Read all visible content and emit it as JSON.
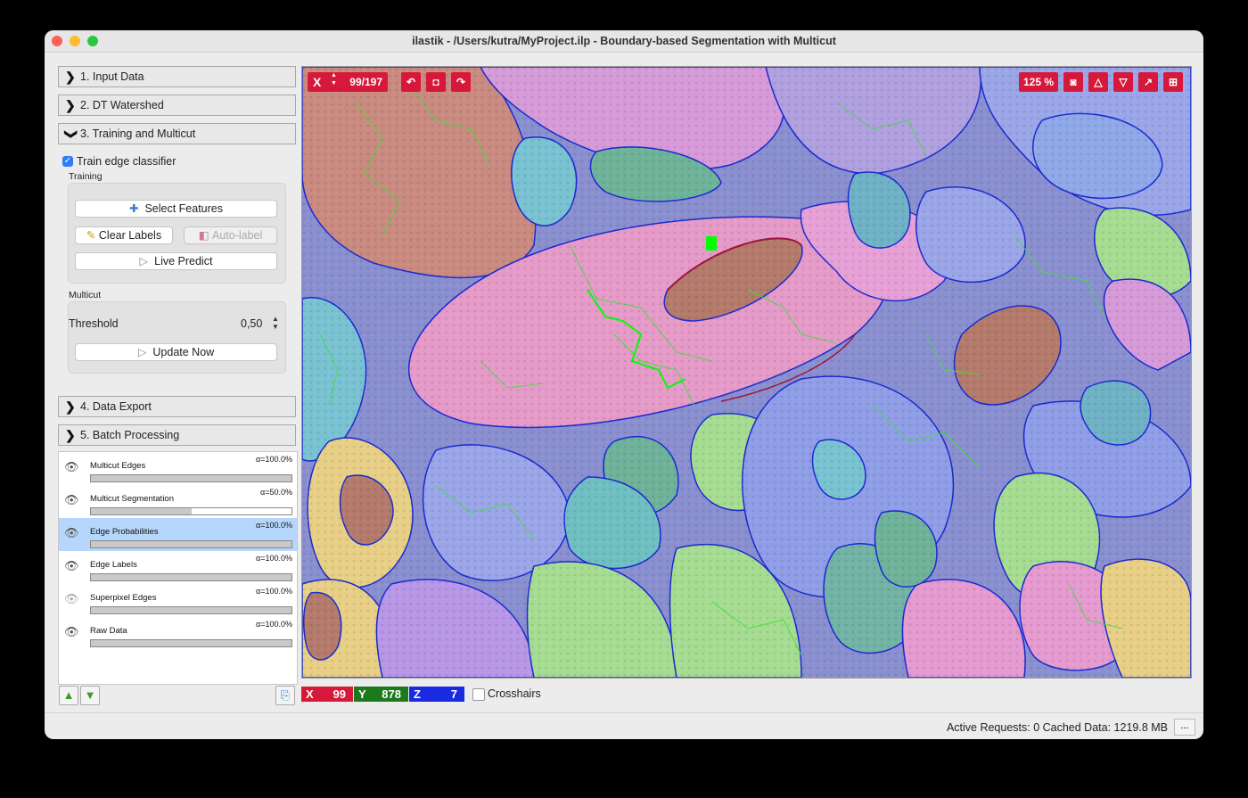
{
  "window": {
    "title": "ilastik - /Users/kutra/MyProject.ilp - Boundary-based Segmentation with Multicut"
  },
  "applets": [
    {
      "label": "1. Input Data",
      "expanded": false
    },
    {
      "label": "2. DT Watershed",
      "expanded": false
    },
    {
      "label": "3. Training and Multicut",
      "expanded": true
    },
    {
      "label": "4. Data Export",
      "expanded": false
    },
    {
      "label": "5. Batch Processing",
      "expanded": false
    }
  ],
  "training_multicut": {
    "train_edge_classifier_label": "Train edge classifier",
    "train_edge_classifier_checked": true,
    "training_group_label": "Training",
    "select_features_label": "Select Features",
    "clear_labels_label": "Clear Labels",
    "auto_label_label": "Auto-label",
    "live_predict_label": "Live Predict",
    "multicut_group_label": "Multicut",
    "threshold_label": "Threshold",
    "threshold_value": "0,50",
    "update_now_label": "Update Now"
  },
  "layers": [
    {
      "name": "Multicut Edges",
      "alpha": "α=100.0%",
      "opacity": 1.0,
      "visible": true,
      "selected": false
    },
    {
      "name": "Multicut Segmentation",
      "alpha": "α=50.0%",
      "opacity": 0.5,
      "visible": true,
      "selected": false
    },
    {
      "name": "Edge Probabilities",
      "alpha": "α=100.0%",
      "opacity": 1.0,
      "visible": true,
      "selected": true
    },
    {
      "name": "Edge Labels",
      "alpha": "α=100.0%",
      "opacity": 1.0,
      "visible": true,
      "selected": false
    },
    {
      "name": "Superpixel Edges",
      "alpha": "α=100.0%",
      "opacity": 1.0,
      "visible": false,
      "selected": false
    },
    {
      "name": "Raw Data",
      "alpha": "α=100.0%",
      "opacity": 1.0,
      "visible": true,
      "selected": false
    }
  ],
  "viewer": {
    "axis_label": "X",
    "slice": "99/197",
    "zoom": "125 %",
    "accent_color": "#d6193a"
  },
  "position": {
    "x_label": "X",
    "x": "99",
    "y_label": "Y",
    "y": "878",
    "z_label": "Z",
    "z": "7",
    "crosshairs_label": "Crosshairs",
    "crosshairs_checked": false
  },
  "status": {
    "text": "Active Requests: 0  Cached Data: 1219.8 MB",
    "more_label": "..."
  }
}
